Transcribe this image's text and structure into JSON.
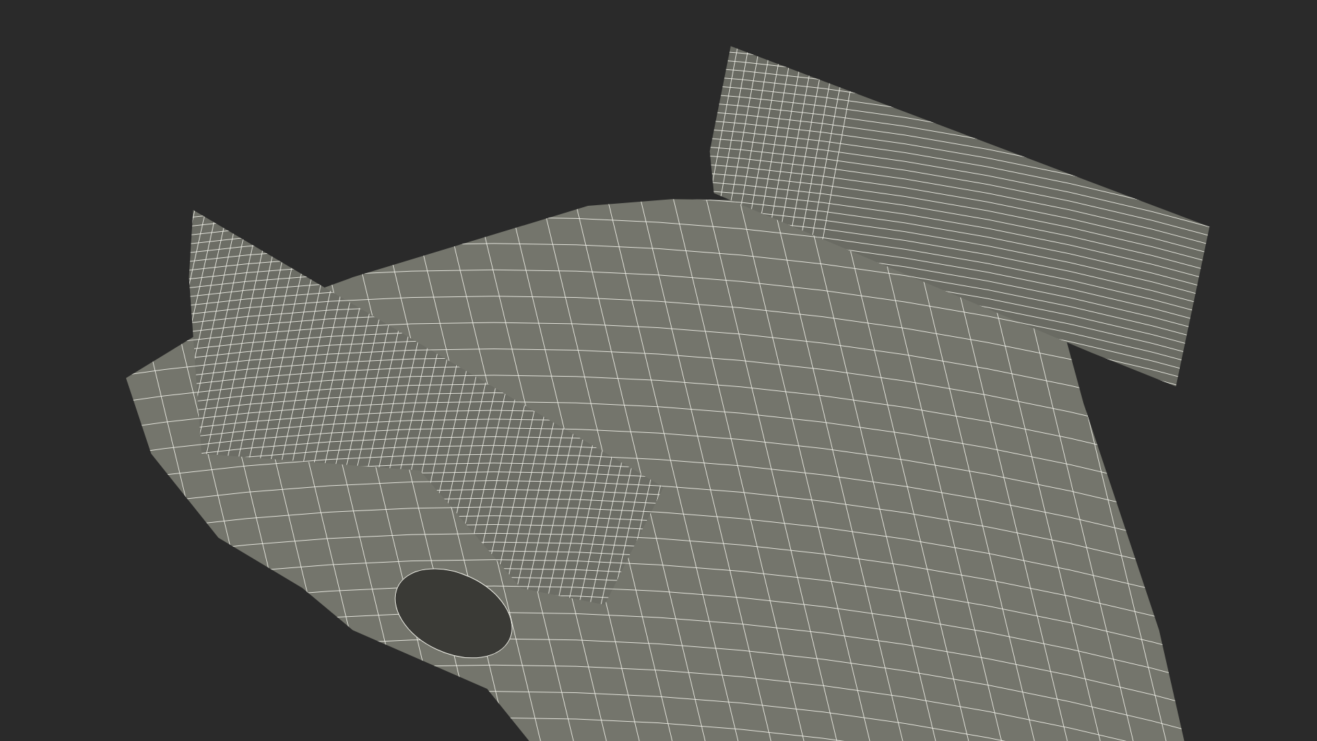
{
  "render": {
    "kind": "wireframe"
  }
}
